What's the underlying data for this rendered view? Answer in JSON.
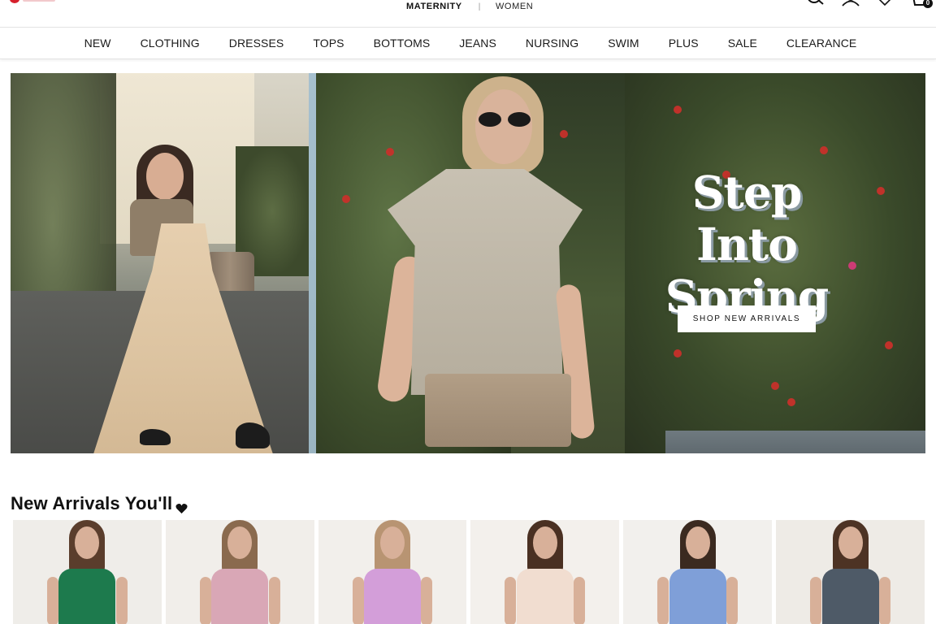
{
  "store_switch": {
    "active": "MATERNITY",
    "other": "WOMEN",
    "separator": "|"
  },
  "icons": {
    "search": "search-icon",
    "account": "account-icon",
    "wishlist": "heart-icon",
    "cart": "cart-icon",
    "cart_count": "0"
  },
  "nav": {
    "items": [
      "NEW",
      "CLOTHING",
      "DRESSES",
      "TOPS",
      "BOTTOMS",
      "JEANS",
      "NURSING",
      "SWIM",
      "PLUS",
      "SALE",
      "CLEARANCE"
    ]
  },
  "hero": {
    "headline_line1": "Step Into",
    "headline_line2": "Spring",
    "cta": "SHOP NEW ARRIVALS"
  },
  "new_arrivals": {
    "title": "New Arrivals You'll",
    "title_icon": "heart-icon",
    "products": [
      {
        "dress_color": "#1d7a4d",
        "hair_color": "#5a3d2c",
        "bg": "#efede9"
      },
      {
        "dress_color": "#d9a7b6",
        "hair_color": "#8a6a4e",
        "bg": "#f1eeea"
      },
      {
        "dress_color": "#d39ed9",
        "hair_color": "#b89472",
        "bg": "#f2efeb"
      },
      {
        "dress_color": "#f1ddd0",
        "hair_color": "#4a3022",
        "bg": "#f3f0ec"
      },
      {
        "dress_color": "#7f9fd8",
        "hair_color": "#3b2a20",
        "bg": "#f2f0ed"
      },
      {
        "dress_color": "#4e5a67",
        "hair_color": "#4d3324",
        "bg": "#eeebe6"
      }
    ]
  },
  "colors": {
    "brand_red": "#d6202c",
    "cta_bg": "#ffffff",
    "text_dark": "#111111"
  }
}
